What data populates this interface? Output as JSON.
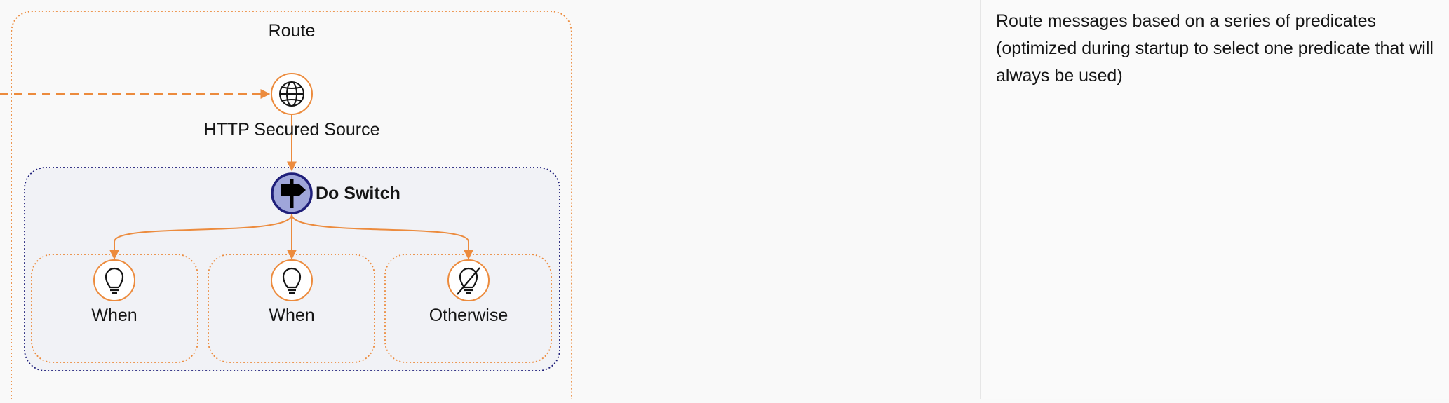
{
  "diagram": {
    "route": {
      "label": "Route"
    },
    "source": {
      "label": "HTTP Secured Source",
      "icon": "globe-icon"
    },
    "switch": {
      "label": "Do Switch",
      "icon": "signpost-icon"
    },
    "branches": [
      {
        "label": "When",
        "icon": "lightbulb-icon"
      },
      {
        "label": "When",
        "icon": "lightbulb-icon"
      },
      {
        "label": "Otherwise",
        "icon": "lightbulb-off-icon"
      }
    ],
    "colors": {
      "edge": "#ec8b3d",
      "route_border": "#ec8b3d",
      "switch_border": "#1f1f7a",
      "switch_fill": "#9fa6da",
      "group_fill": "#f1f2f6",
      "node_fill": "#ffffff"
    }
  },
  "side_panel": {
    "description": "Route messages based on a series of predicates (optimized during startup to select one predicate that will always be used)"
  }
}
